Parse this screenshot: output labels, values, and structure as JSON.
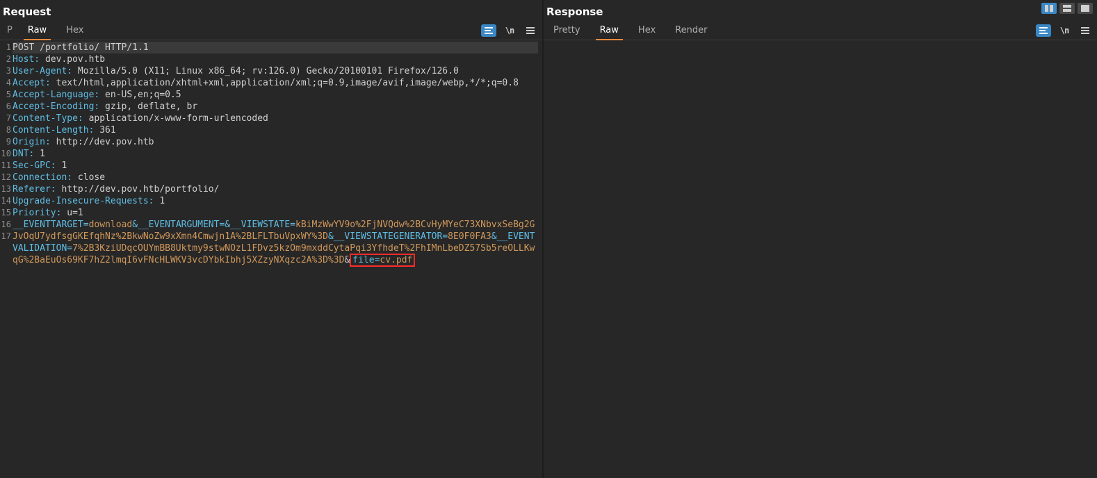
{
  "request": {
    "title": "Request",
    "search_letter": "P",
    "tabs": {
      "raw": "Raw",
      "hex": "Hex",
      "active": "raw"
    },
    "icons": {
      "pretty": "pretty-format-icon",
      "newline": "\\n",
      "menu": "hamburger-icon"
    },
    "lines": [
      {
        "n": 1,
        "hl": true,
        "segments": [
          {
            "c": "plain",
            "t": "POST /portfolio/ HTTP/1.1"
          }
        ]
      },
      {
        "n": 2,
        "segments": [
          {
            "c": "hname",
            "t": "Host:"
          },
          {
            "c": "hval",
            "t": " dev.pov.htb"
          }
        ]
      },
      {
        "n": 3,
        "segments": [
          {
            "c": "hname",
            "t": "User-Agent:"
          },
          {
            "c": "hval",
            "t": " Mozilla/5.0 (X11; Linux x86_64; rv:126.0) Gecko/20100101 Firefox/126.0"
          }
        ]
      },
      {
        "n": 4,
        "segments": [
          {
            "c": "hname",
            "t": "Accept:"
          },
          {
            "c": "hval",
            "t": " text/html,application/xhtml+xml,application/xml;q=0.9,image/avif,image/webp,*/*;q=0.8"
          }
        ]
      },
      {
        "n": 5,
        "segments": [
          {
            "c": "hname",
            "t": "Accept-Language:"
          },
          {
            "c": "hval",
            "t": " en-US,en;q=0.5"
          }
        ]
      },
      {
        "n": 6,
        "segments": [
          {
            "c": "hname",
            "t": "Accept-Encoding:"
          },
          {
            "c": "hval",
            "t": " gzip, deflate, br"
          }
        ]
      },
      {
        "n": 7,
        "segments": [
          {
            "c": "hname",
            "t": "Content-Type:"
          },
          {
            "c": "hval",
            "t": " application/x-www-form-urlencoded"
          }
        ]
      },
      {
        "n": 8,
        "segments": [
          {
            "c": "hname",
            "t": "Content-Length:"
          },
          {
            "c": "hval",
            "t": " 361"
          }
        ]
      },
      {
        "n": 9,
        "segments": [
          {
            "c": "hname",
            "t": "Origin:"
          },
          {
            "c": "hval",
            "t": " http://dev.pov.htb"
          }
        ]
      },
      {
        "n": 10,
        "segments": [
          {
            "c": "hname",
            "t": "DNT:"
          },
          {
            "c": "hval",
            "t": " 1"
          }
        ]
      },
      {
        "n": 11,
        "segments": [
          {
            "c": "hname",
            "t": "Sec-GPC:"
          },
          {
            "c": "hval",
            "t": " 1"
          }
        ]
      },
      {
        "n": 12,
        "segments": [
          {
            "c": "hname",
            "t": "Connection:"
          },
          {
            "c": "hval",
            "t": " close"
          }
        ]
      },
      {
        "n": 13,
        "segments": [
          {
            "c": "hname",
            "t": "Referer:"
          },
          {
            "c": "hval",
            "t": " http://dev.pov.htb/portfolio/"
          }
        ]
      },
      {
        "n": 14,
        "segments": [
          {
            "c": "hname",
            "t": "Upgrade-Insecure-Requests:"
          },
          {
            "c": "hval",
            "t": " 1"
          }
        ]
      },
      {
        "n": 15,
        "segments": [
          {
            "c": "hname",
            "t": "Priority:"
          },
          {
            "c": "hval",
            "t": " u=1"
          }
        ]
      },
      {
        "n": 16,
        "segments": [
          {
            "c": "plain",
            "t": ""
          }
        ]
      },
      {
        "n": 17,
        "segments": [
          {
            "c": "pkey",
            "t": "__EVENTTARGET="
          },
          {
            "c": "pval",
            "t": "download"
          },
          {
            "c": "pkey",
            "t": "&__EVENTARGUMENT="
          },
          {
            "c": "pkey",
            "t": "&__VIEWSTATE="
          },
          {
            "c": "pval",
            "t": "kBiMzWwYV9o%2FjNVQdw%2BCvHyMYeC73XNbvxSeBg2GJvOqU7ydfsgGKEfqhNz%2BkwNoZw9xXmn4Cmwjn1A%2BLFLTbuVpxWY%3D"
          },
          {
            "c": "pkey",
            "t": "&__VIEWSTATEGENERATOR="
          },
          {
            "c": "pval",
            "t": "8E0F0FA3"
          },
          {
            "c": "pkey",
            "t": "&__EVENTVALIDATION="
          },
          {
            "c": "pval",
            "t": "7%2B3KziUDqcOUYmBB8Uktmy9stwNOzL1FDvz5kzOm9mxddCytaPqi3YfhdeT%2FhIMnLbeDZ57Sb5reOLLKwqG%2BaEuOs69KF7hZ2lmqI6vFNcHLWKV3vcDYbkIbhj5XZzyNXqzc2A%3D%3D"
          },
          {
            "c": "plain",
            "t": "&"
          },
          {
            "c": "annot",
            "inner": [
              {
                "c": "pkey",
                "t": "file="
              },
              {
                "c": "pval",
                "t": "cv.pdf"
              }
            ]
          }
        ]
      }
    ]
  },
  "response": {
    "title": "Response",
    "tabs": {
      "pretty": "Pretty",
      "raw": "Raw",
      "hex": "Hex",
      "render": "Render",
      "active": "raw"
    },
    "icons": {
      "pretty": "pretty-format-icon",
      "newline": "\\n",
      "menu": "hamburger-icon"
    },
    "lines": []
  },
  "layout_buttons": {
    "columns": "layout-columns",
    "rows": "layout-rows",
    "single": "layout-single",
    "active": "columns"
  }
}
